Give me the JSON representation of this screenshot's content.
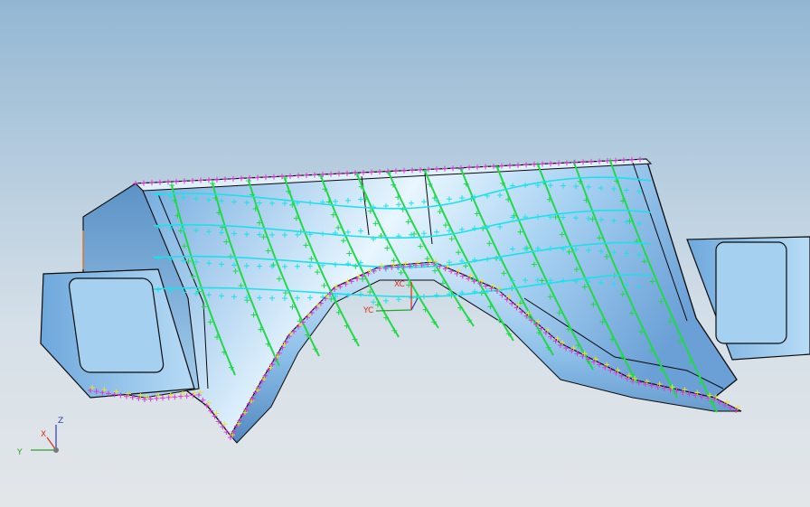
{
  "viewport": {
    "background_top": "#93b7d3",
    "background_bottom": "#e3e6e9"
  },
  "wcs": {
    "xc_label": "XC",
    "yc_label": "YC",
    "xc_color": "#d4301b",
    "yc_color": "#2aa52a"
  },
  "triad": {
    "x_label": "X",
    "y_label": "Y",
    "z_label": "Z",
    "x_color": "#d4301b",
    "y_color": "#2aa52a",
    "z_color": "#2a3cb8"
  },
  "model": {
    "surface_color": "#7fb8e8",
    "highlight_color": "#e8f6ff",
    "edge_color": "#0a0a0a",
    "isoline_colors": [
      "#22d84a",
      "#1ee0e8",
      "#d63ad6",
      "#e8e23a"
    ]
  }
}
